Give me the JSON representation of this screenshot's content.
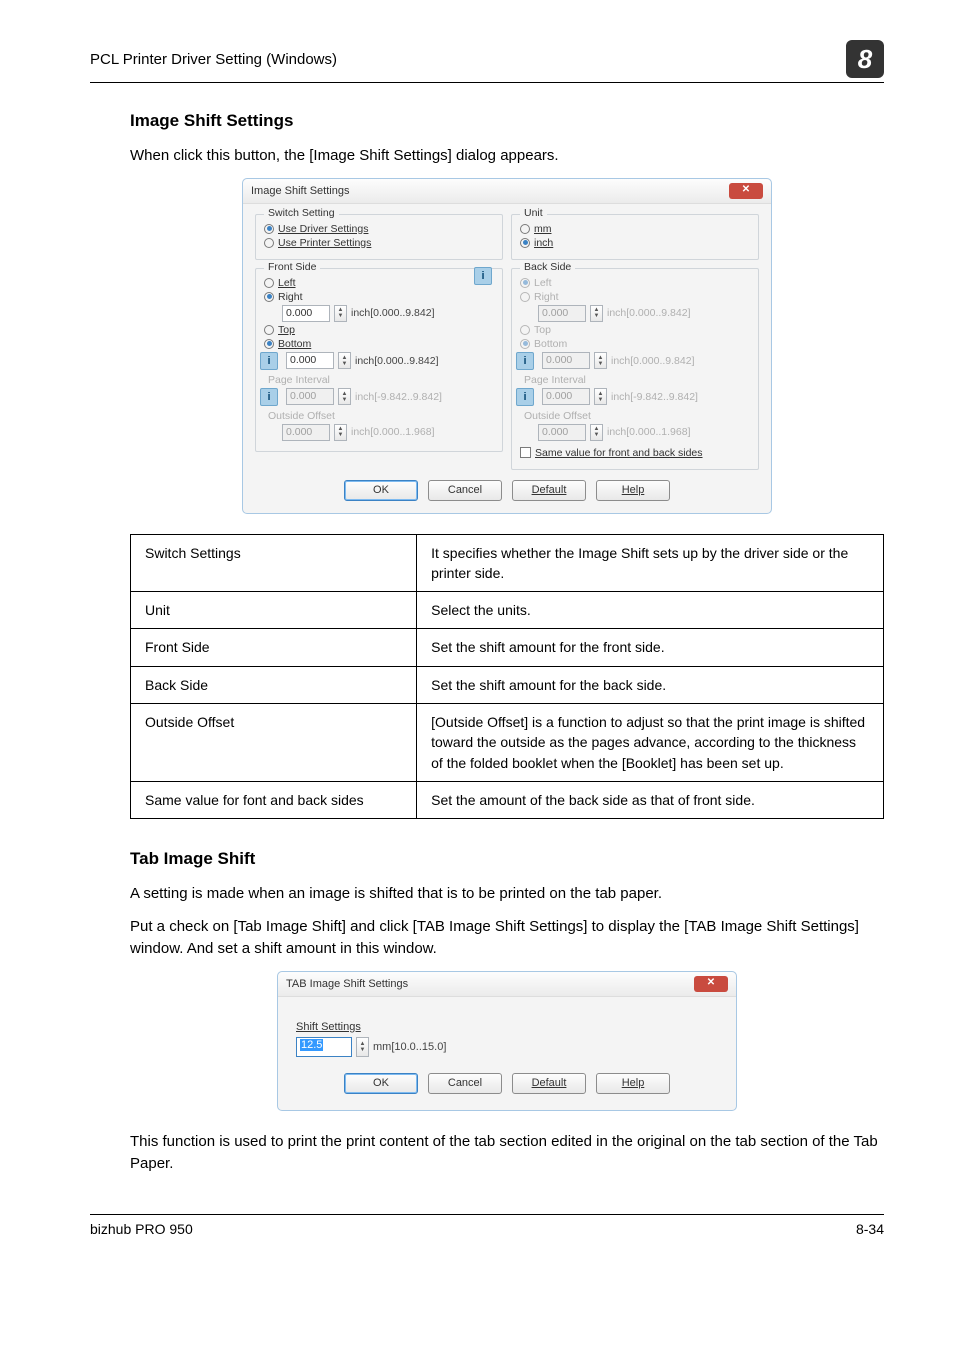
{
  "header": {
    "title": "PCL Printer Driver Setting (Windows)",
    "chapter_number": "8"
  },
  "section1": {
    "heading": "Image Shift Settings",
    "intro": "When click this button, the [Image Shift Settings] dialog appears."
  },
  "imageShiftDialog": {
    "title": "Image Shift Settings",
    "switchSetting": {
      "legend": "Switch Setting",
      "useDriver": "Use Driver Settings",
      "usePrinter": "Use Printer Settings"
    },
    "unit": {
      "legend": "Unit",
      "mm": "mm",
      "inch": "inch"
    },
    "frontSide": {
      "legend": "Front Side",
      "left": "Left",
      "right": "Right",
      "top": "Top",
      "bottom": "Bottom",
      "range1": "inch[0.000..9.842]",
      "range2": "inch[0.000..9.842]",
      "pageInterval": "Page Interval",
      "pageIntervalRange": "inch[-9.842..9.842]",
      "outsideOffset": "Outside Offset",
      "outsideOffsetRange": "inch[0.000..1.968]",
      "value1": "0.000",
      "value2": "0.000",
      "value3": "0.000",
      "value4": "0.000"
    },
    "backSide": {
      "legend": "Back Side",
      "left": "Left",
      "right": "Right",
      "top": "Top",
      "bottom": "Bottom",
      "range1": "inch[0.000..9.842]",
      "range2": "inch[0.000..9.842]",
      "pageInterval": "Page Interval",
      "pageIntervalRange": "inch[-9.842..9.842]",
      "outsideOffset": "Outside Offset",
      "outsideOffsetRange": "inch[0.000..1.968]",
      "value1": "0.000",
      "value2": "0.000",
      "value3": "0.000",
      "value4": "0.000"
    },
    "sameValueCheckbox": "Same value for front and back sides",
    "buttons": {
      "ok": "OK",
      "cancel": "Cancel",
      "default": "Default",
      "help": "Help"
    }
  },
  "specTable": {
    "rows": [
      [
        "Switch Settings",
        "It specifies whether the Image Shift sets up by the driver side or the printer side."
      ],
      [
        "Unit",
        "Select the units."
      ],
      [
        "Front Side",
        "Set the shift amount for the front side."
      ],
      [
        "Back Side",
        "Set the shift amount for the back side."
      ],
      [
        "Outside Offset",
        "[Outside Offset] is a function to adjust so that the print image is shifted toward the outside as the pages advance, according to the thickness of the folded booklet when the [Booklet] has been set up."
      ],
      [
        "Same value for font and back sides",
        "Set the amount of the back side as that of front side."
      ]
    ]
  },
  "section2": {
    "heading": "Tab Image Shift",
    "p1": "A setting is made when an image is shifted that is to be printed on the tab paper.",
    "p2": "Put a check on [Tab Image Shift] and click [TAB Image Shift Settings] to display the [TAB Image Shift Settings] window. And set a shift amount in this window."
  },
  "tabDialog": {
    "title": "TAB Image Shift Settings",
    "shiftSettings": "Shift Settings",
    "value": "12.5",
    "range": "mm[10.0..15.0]",
    "buttons": {
      "ok": "OK",
      "cancel": "Cancel",
      "default": "Default",
      "help": "Help"
    }
  },
  "paragraphAfter": "This function is used to print the print content of the tab section edited in the original on the tab section of the Tab Paper.",
  "footer": {
    "left": "bizhub PRO 950",
    "right": "8-34"
  }
}
